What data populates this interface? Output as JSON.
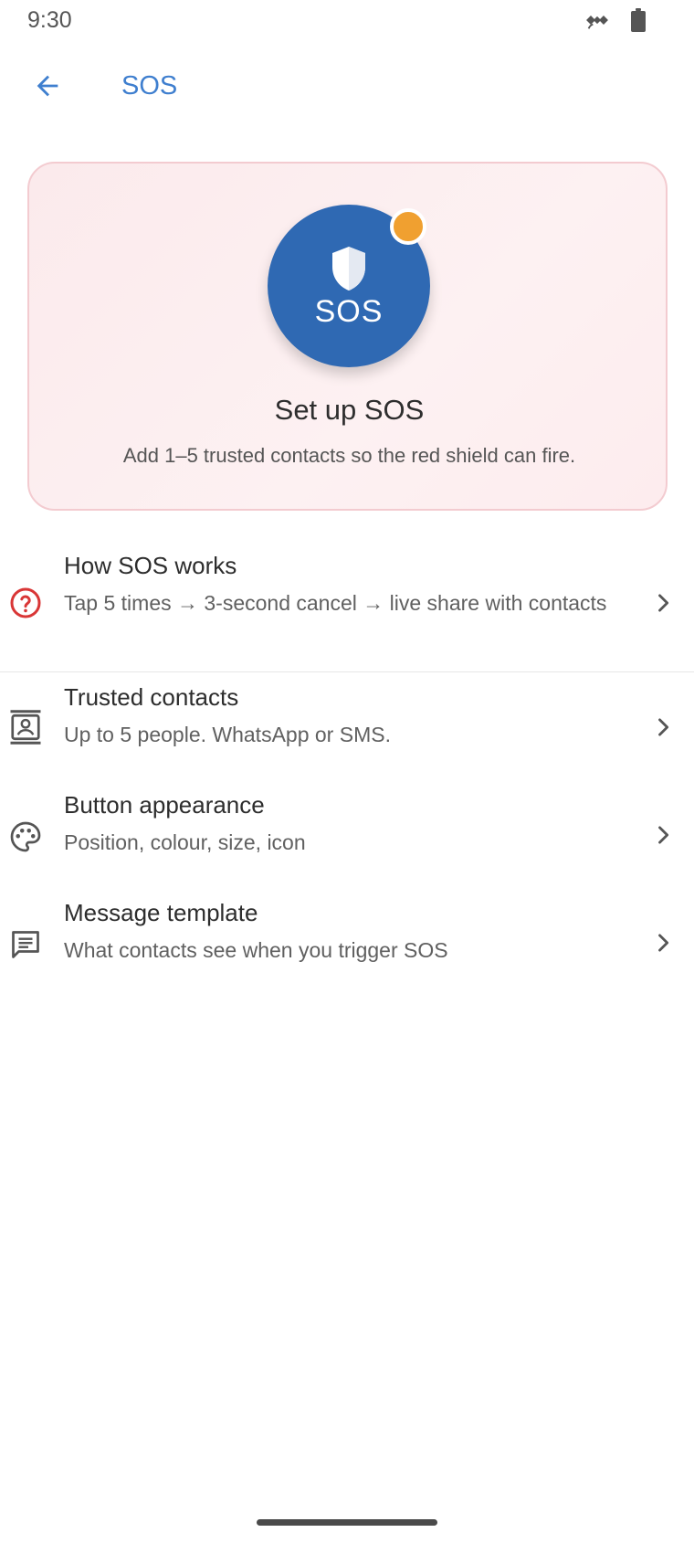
{
  "status_bar": {
    "time": "9:30",
    "icons": [
      "satellite-icon",
      "battery-icon"
    ]
  },
  "app_bar": {
    "title": "SOS",
    "back_icon": "arrow-back-icon",
    "accent_color": "#3f7fcf"
  },
  "hero": {
    "badge_label": "SOS",
    "title": "Set up SOS",
    "subtitle": "Add 1–5 trusted contacts so the red shield can fire.",
    "circle_color": "#2f69b3",
    "dot_color": "#f0a030"
  },
  "settings": [
    {
      "icon": "help-circle-icon",
      "icon_color": "#d93636",
      "title": "How SOS works",
      "subtitle": "Tap 5 times → 3-second cancel → live share with contacts"
    },
    {
      "icon": "contacts-icon",
      "icon_color": "#555555",
      "title": "Trusted contacts",
      "subtitle": "Up to 5 people. WhatsApp or SMS."
    },
    {
      "icon": "palette-icon",
      "icon_color": "#555555",
      "title": "Button appearance",
      "subtitle": "Position, colour, size, icon"
    },
    {
      "icon": "message-icon",
      "icon_color": "#555555",
      "title": "Message template",
      "subtitle": "What contacts see when you trigger SOS"
    }
  ]
}
